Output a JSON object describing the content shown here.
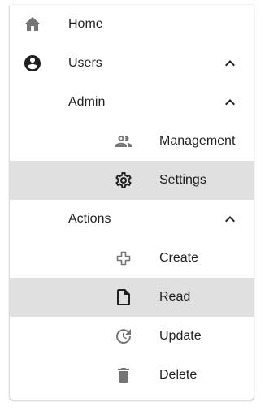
{
  "nav": {
    "home": {
      "label": "Home",
      "icon": "home-icon"
    },
    "users": {
      "label": "Users",
      "icon": "account-circle-icon",
      "expanded": true
    },
    "admin": {
      "label": "Admin",
      "expanded": true
    },
    "management": {
      "label": "Management",
      "icon": "people-outline-icon"
    },
    "settings": {
      "label": "Settings",
      "icon": "gear-icon",
      "selected": true
    },
    "actions": {
      "label": "Actions",
      "expanded": true
    },
    "create": {
      "label": "Create",
      "icon": "add-outline-icon"
    },
    "read": {
      "label": "Read",
      "icon": "file-icon",
      "selected": true
    },
    "update": {
      "label": "Update",
      "icon": "update-icon"
    },
    "delete": {
      "label": "Delete",
      "icon": "trash-icon"
    }
  },
  "colors": {
    "icon": "#757575",
    "icon_dark": "#212121",
    "text": "#212121",
    "selected_bg": "#e0e0e0"
  }
}
